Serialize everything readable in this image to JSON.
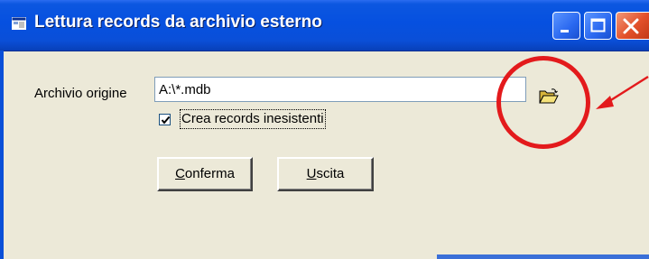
{
  "window": {
    "title": "Lettura records da archivio esterno",
    "icon": "app-window-icon",
    "controls": {
      "minimize": "minimize-icon",
      "maximize": "maximize-icon",
      "close": "close-icon"
    }
  },
  "form": {
    "archivio_label": "Archivio origine",
    "archivio_value": "A:\\*.mdb",
    "browse_icon": "folder-open-icon",
    "checkbox_label": "Crea records inesistenti",
    "checkbox_checked": true,
    "conferma_prefix": "C",
    "conferma_rest": "onferma",
    "uscita_prefix": "U",
    "uscita_rest": "scita"
  },
  "annotation": {
    "circle_color": "#e31a1c",
    "arrow_color": "#e31a1c"
  }
}
